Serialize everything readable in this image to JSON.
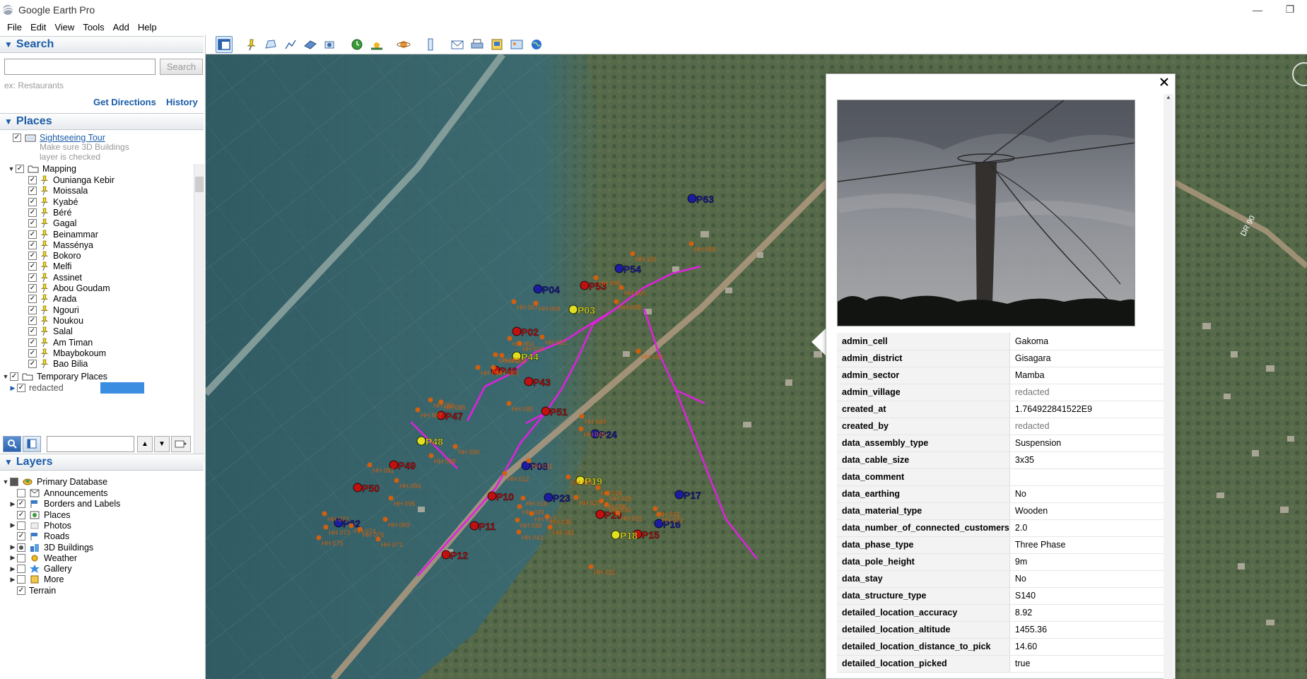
{
  "window": {
    "title": "Google Earth Pro"
  },
  "menu": [
    "File",
    "Edit",
    "View",
    "Tools",
    "Add",
    "Help"
  ],
  "search": {
    "header": "Search",
    "placeholder": "",
    "button": "Search",
    "hint": "ex: Restaurants",
    "get_directions": "Get Directions",
    "history": "History"
  },
  "places": {
    "header": "Places",
    "sightseeing": "Sightseeing Tour",
    "sightseeing_note1": "Make sure 3D Buildings",
    "sightseeing_note2": "layer is checked",
    "mapping_label": "Mapping",
    "mapping_items": [
      "Ounianga Kebir",
      "Moissala",
      "Kyabé",
      "Béré",
      "Gagal",
      "Beinammar",
      "Massénya",
      "Bokoro",
      "Melfi",
      "Assinet",
      "Abou Goudam",
      "Arada",
      "Ngouri",
      "Noukou",
      "Salal",
      "Am Timan",
      "Mbaybokoum",
      "Bao Bilia"
    ],
    "temporary_label": "Temporary Places",
    "temporary_item": "redacted"
  },
  "layers": {
    "header": "Layers",
    "root": "Primary Database",
    "items": [
      {
        "label": "Announcements",
        "checked": false,
        "expander": false
      },
      {
        "label": "Borders and Labels",
        "checked": true,
        "expander": true
      },
      {
        "label": "Places",
        "checked": true,
        "expander": false
      },
      {
        "label": "Photos",
        "checked": false,
        "expander": true
      },
      {
        "label": "Roads",
        "checked": true,
        "expander": false
      },
      {
        "label": "3D Buildings",
        "checked": "partial",
        "expander": true
      },
      {
        "label": "Weather",
        "checked": false,
        "expander": true
      },
      {
        "label": "Gallery",
        "checked": false,
        "expander": true
      },
      {
        "label": "More",
        "checked": false,
        "expander": true
      }
    ],
    "terrain": "Terrain"
  },
  "map": {
    "road_label": "DR 90",
    "poles": [
      {
        "label": "P01",
        "color": "#1c1ca0"
      },
      {
        "label": "P02",
        "color": "#c01010"
      },
      {
        "label": "P03",
        "color": "#e0e020"
      },
      {
        "label": "P04",
        "color": "#1c1ca0"
      },
      {
        "label": "P08",
        "color": "#1c1ca0"
      },
      {
        "label": "P10",
        "color": "#c01010"
      },
      {
        "label": "P11",
        "color": "#c01010"
      },
      {
        "label": "P12",
        "color": "#c01010"
      },
      {
        "label": "P15",
        "color": "#c01010"
      },
      {
        "label": "P16",
        "color": "#1c1ca0"
      },
      {
        "label": "P17",
        "color": "#1c1ca0"
      },
      {
        "label": "P18",
        "color": "#e0e020"
      },
      {
        "label": "P19",
        "color": "#e0e020"
      },
      {
        "label": "P20",
        "color": "#c01010"
      },
      {
        "label": "P23",
        "color": "#1c1ca0"
      },
      {
        "label": "P24",
        "color": "#1c1ca0"
      },
      {
        "label": "P43",
        "color": "#c01010"
      },
      {
        "label": "P44",
        "color": "#e0e020"
      },
      {
        "label": "P46",
        "color": "#c01010"
      },
      {
        "label": "P47",
        "color": "#c01010"
      },
      {
        "label": "P48",
        "color": "#e0e020"
      },
      {
        "label": "P49",
        "color": "#c01010"
      },
      {
        "label": "P50",
        "color": "#c01010"
      },
      {
        "label": "P51",
        "color": "#c01010"
      },
      {
        "label": "P53",
        "color": "#c01010"
      },
      {
        "label": "P54",
        "color": "#1c1ca0"
      },
      {
        "label": "P62",
        "color": "#1c1ca0"
      },
      {
        "label": "P63",
        "color": "#1c1ca0"
      }
    ],
    "households": [
      "HH 002",
      "HH 003",
      "HH 004",
      "HH 007",
      "HH 008",
      "HH 010",
      "HH 011",
      "HH 012",
      "HH 016",
      "HH 017",
      "HH 021",
      "HH 024",
      "HH 025",
      "HH 026",
      "HH 027",
      "HH 028",
      "HH 030",
      "HH 031",
      "HH 032",
      "HH 033",
      "HH 035",
      "HH 038",
      "HH 039",
      "HH 042",
      "HH 043",
      "HH 044",
      "HH 045",
      "HH 058",
      "HH 063",
      "HH 069",
      "HH 071",
      "HH 072",
      "HH 073",
      "HH 074",
      "HH 075",
      "HH 076",
      "HH 080",
      "HH 082",
      "HH 083",
      "HH 084",
      "HH 085",
      "HH 086",
      "HH 087",
      "HH 088",
      "HH 090",
      "HH 092",
      "HH 093",
      "HH 095",
      "HH 098",
      "HH 099",
      "HH 100",
      "HH 101",
      "HH 103"
    ]
  },
  "balloon": {
    "attributes": [
      {
        "key": "admin_cell",
        "value": "Gakoma"
      },
      {
        "key": "admin_district",
        "value": "Gisagara"
      },
      {
        "key": "admin_sector",
        "value": "Mamba"
      },
      {
        "key": "admin_village",
        "value": "redacted"
      },
      {
        "key": "created_at",
        "value": "1.764922841522E9"
      },
      {
        "key": "created_by",
        "value": "redacted"
      },
      {
        "key": "data_assembly_type",
        "value": "Suspension"
      },
      {
        "key": "data_cable_size",
        "value": "3x35"
      },
      {
        "key": "data_comment",
        "value": ""
      },
      {
        "key": "data_earthing",
        "value": "No"
      },
      {
        "key": "data_material_type",
        "value": "Wooden"
      },
      {
        "key": "data_number_of_connected_customers",
        "value": "2.0"
      },
      {
        "key": "data_phase_type",
        "value": "Three Phase"
      },
      {
        "key": "data_pole_height",
        "value": "9m"
      },
      {
        "key": "data_stay",
        "value": "No"
      },
      {
        "key": "data_structure_type",
        "value": "S140"
      },
      {
        "key": "detailed_location_accuracy",
        "value": "8.92"
      },
      {
        "key": "detailed_location_altitude",
        "value": "1455.36"
      },
      {
        "key": "detailed_location_distance_to_pick",
        "value": "14.60"
      },
      {
        "key": "detailed_location_picked",
        "value": "true"
      }
    ]
  },
  "colors": {
    "accent": "#1a5ca8",
    "line": "#e020e0",
    "pole_red": "#c01010",
    "pole_blue": "#1c1ca0",
    "pole_yellow": "#e0e020",
    "household": "#d06010"
  }
}
